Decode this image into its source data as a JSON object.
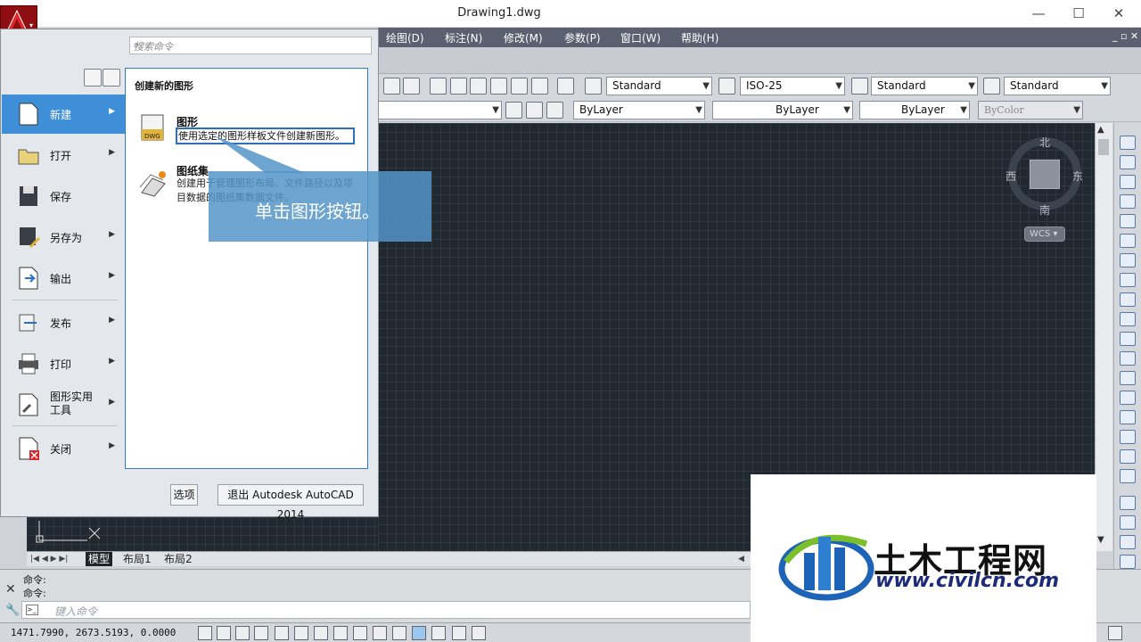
{
  "window": {
    "title": "Drawing1.dwg",
    "minimize": "—",
    "maximize": "☐",
    "close": "✕"
  },
  "menubar": [
    "绘图(D)",
    "标注(N)",
    "修改(M)",
    "参数(P)",
    "窗口(W)",
    "帮助(H)"
  ],
  "toolbar": {
    "text_style": "Standard",
    "dim_style": "ISO-25",
    "table_style": "Standard",
    "multileader_style": "Standard",
    "layer_color": "ByLayer",
    "linetype": "ByLayer",
    "lineweight": "ByLayer",
    "plot_style": "ByColor"
  },
  "app_menu": {
    "search_placeholder": "搜索命令",
    "items": [
      {
        "label": "新建",
        "has_submenu": true,
        "active": true
      },
      {
        "label": "打开",
        "has_submenu": true
      },
      {
        "label": "保存",
        "has_submenu": false
      },
      {
        "label": "另存为",
        "has_submenu": true
      },
      {
        "label": "输出",
        "has_submenu": true
      },
      {
        "label": "发布",
        "has_submenu": true
      },
      {
        "label": "打印",
        "has_submenu": true
      },
      {
        "label": "图形实用工具",
        "line1": "图形实用",
        "line2": "工具",
        "has_submenu": true
      },
      {
        "label": "关闭",
        "has_submenu": true
      }
    ],
    "panel": {
      "heading": "创建新的图形",
      "entries": [
        {
          "title": "图形",
          "desc": "使用选定的图形样板文件创建新图形。"
        },
        {
          "title": "图纸集",
          "desc_line1": "创建用于管理图形布局、文件路径以及项",
          "desc_line2": "目数据的图纸集数据文件。"
        }
      ]
    },
    "options_button": "选项",
    "exit_button": "退出 Autodesk AutoCAD 2014"
  },
  "callout": "单击图形按钮。",
  "viewcube": {
    "north": "北",
    "south": "南",
    "east": "东",
    "west": "西",
    "wcs": "WCS"
  },
  "layout_tabs": [
    "模型",
    "布局1",
    "布局2"
  ],
  "command": {
    "history": [
      "命令:",
      "命令:"
    ],
    "placeholder": "键入命令"
  },
  "status": {
    "coords": "1471.7990, 2673.5193, 0.0000"
  },
  "watermark": {
    "name": "土木工程网",
    "url": "www.civilcn.com"
  }
}
